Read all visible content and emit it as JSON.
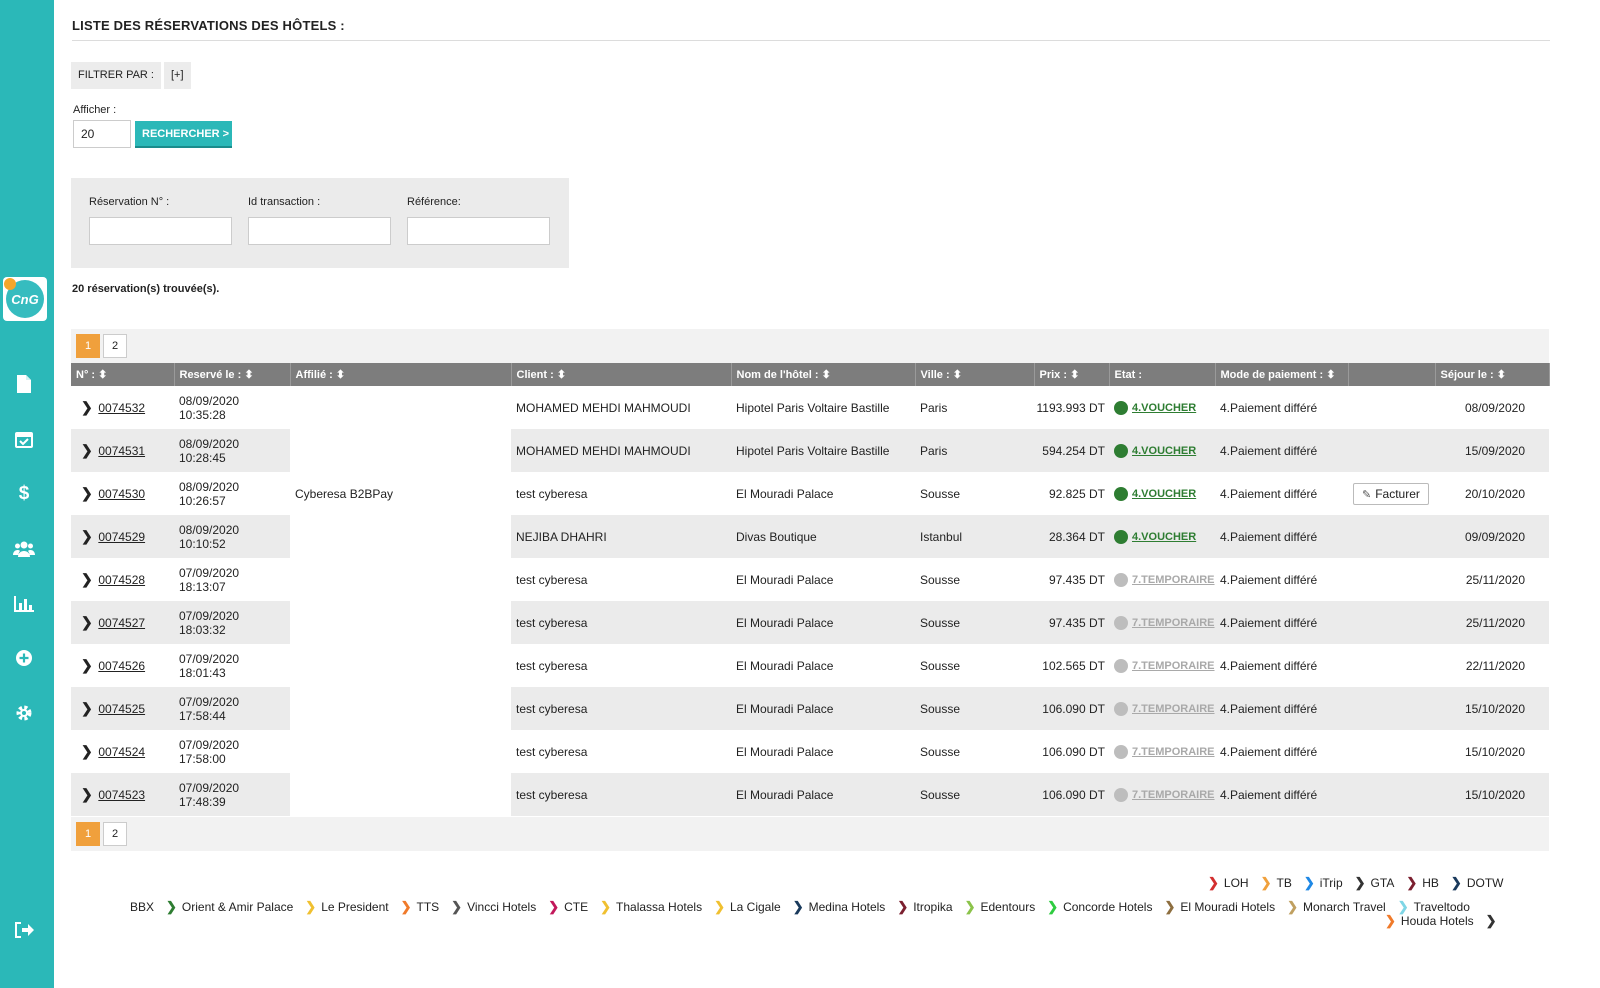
{
  "page": {
    "title": "LISTE DES RÉSERVATIONS DES HÔTELS :",
    "filter_label": "FILTRER PAR :",
    "filter_toggle": "[+]",
    "afficher_label": "Afficher :",
    "afficher_value": "20",
    "search_button": "RECHERCHER >",
    "found_text": "20 réservation(s) trouvée(s)."
  },
  "search": {
    "reservation_label": "Réservation N° :",
    "transaction_label": "Id transaction :",
    "reference_label": "Référence:"
  },
  "pagination": {
    "pages": [
      "1",
      "2"
    ],
    "current": "1"
  },
  "table": {
    "columns": [
      "N° : ⬍",
      "Reservé le : ⬍",
      "Affilié : ⬍",
      "Client : ⬍",
      "Nom de l'hôtel : ⬍",
      "Ville : ⬍",
      "Prix : ⬍",
      "Etat :",
      "Mode de paiement : ⬍",
      "",
      "Séjour le : ⬍"
    ],
    "facturer_label": "Facturer",
    "rows": [
      {
        "num": "0074532",
        "date": "08/09/2020",
        "time": "10:35:28",
        "affilie": "",
        "client": "MOHAMED MEHDI MAHMOUDI",
        "hotel": "Hipotel Paris Voltaire Bastille",
        "ville": "Paris",
        "prix": "1193.993 DT",
        "etat": "4.VOUCHER",
        "paiement": "4.Paiement différé",
        "sejour": "08/09/2020"
      },
      {
        "num": "0074531",
        "date": "08/09/2020",
        "time": "10:28:45",
        "affilie": "",
        "client": "MOHAMED MEHDI MAHMOUDI",
        "hotel": "Hipotel Paris Voltaire Bastille",
        "ville": "Paris",
        "prix": "594.254 DT",
        "etat": "4.VOUCHER",
        "paiement": "4.Paiement différé",
        "sejour": "15/09/2020"
      },
      {
        "num": "0074530",
        "date": "08/09/2020",
        "time": "10:26:57",
        "affilie": "Cyberesa B2BPay",
        "client": "test cyberesa",
        "hotel": "El Mouradi Palace",
        "ville": "Sousse",
        "prix": "92.825 DT",
        "etat": "4.VOUCHER",
        "paiement": "4.Paiement différé",
        "sejour": "20/10/2020"
      },
      {
        "num": "0074529",
        "date": "08/09/2020",
        "time": "10:10:52",
        "affilie": "",
        "client": "NEJIBA DHAHRI",
        "hotel": "Divas Boutique",
        "ville": "Istanbul",
        "prix": "28.364 DT",
        "etat": "4.VOUCHER",
        "paiement": "4.Paiement différé",
        "sejour": "09/09/2020"
      },
      {
        "num": "0074528",
        "date": "07/09/2020",
        "time": "18:13:07",
        "affilie": "",
        "client": "test cyberesa",
        "hotel": "El Mouradi Palace",
        "ville": "Sousse",
        "prix": "97.435 DT",
        "etat": "7.TEMPORAIRE",
        "paiement": "4.Paiement différé",
        "sejour": "25/11/2020"
      },
      {
        "num": "0074527",
        "date": "07/09/2020",
        "time": "18:03:32",
        "affilie": "",
        "client": "test cyberesa",
        "hotel": "El Mouradi Palace",
        "ville": "Sousse",
        "prix": "97.435 DT",
        "etat": "7.TEMPORAIRE",
        "paiement": "4.Paiement différé",
        "sejour": "25/11/2020"
      },
      {
        "num": "0074526",
        "date": "07/09/2020",
        "time": "18:01:43",
        "affilie": "",
        "client": "test cyberesa",
        "hotel": "El Mouradi Palace",
        "ville": "Sousse",
        "prix": "102.565 DT",
        "etat": "7.TEMPORAIRE",
        "paiement": "4.Paiement différé",
        "sejour": "22/11/2020"
      },
      {
        "num": "0074525",
        "date": "07/09/2020",
        "time": "17:58:44",
        "affilie": "",
        "client": "test cyberesa",
        "hotel": "El Mouradi Palace",
        "ville": "Sousse",
        "prix": "106.090 DT",
        "etat": "7.TEMPORAIRE",
        "paiement": "4.Paiement différé",
        "sejour": "15/10/2020"
      },
      {
        "num": "0074524",
        "date": "07/09/2020",
        "time": "17:58:00",
        "affilie": "",
        "client": "test cyberesa",
        "hotel": "El Mouradi Palace",
        "ville": "Sousse",
        "prix": "106.090 DT",
        "etat": "7.TEMPORAIRE",
        "paiement": "4.Paiement différé",
        "sejour": "15/10/2020"
      },
      {
        "num": "0074523",
        "date": "07/09/2020",
        "time": "17:48:39",
        "affilie": "",
        "client": "test cyberesa",
        "hotel": "El Mouradi Palace",
        "ville": "Sousse",
        "prix": "106.090 DT",
        "etat": "7.TEMPORAIRE",
        "paiement": "4.Paiement différé",
        "sejour": "15/10/2020"
      }
    ]
  },
  "status_colors": {
    "voucher": "#2e7d32",
    "temporaire": "#bdbdbd",
    "voucher_text": "#2e7d32",
    "temporaire_text": "#a9a9a9"
  },
  "colors": {
    "sidebar": "#2bb8b8",
    "accent_orange": "#f0a03c",
    "header_gray": "#7d7d7d"
  },
  "sidebar_icons": [
    "document-icon",
    "calendar-check-icon",
    "dollar-icon",
    "users-icon",
    "bar-chart-icon",
    "plus-circle-icon",
    "gear-icon",
    "logout-icon"
  ],
  "partners_row1": [
    {
      "name": "LOH",
      "color": "#d32f2f"
    },
    {
      "name": "TB",
      "color": "#f0a03c"
    },
    {
      "name": "iTrip",
      "color": "#1e88e5"
    },
    {
      "name": "GTA",
      "color": "#333333"
    },
    {
      "name": "HB",
      "color": "#7b1f2f"
    },
    {
      "name": "DOTW",
      "color": "#1a3a5c"
    }
  ],
  "partners_row2": [
    {
      "name": "BBX",
      "color": ""
    },
    {
      "name": "Orient & Amir Palace",
      "color": "#2e7d32"
    },
    {
      "name": "Le President",
      "color": "#f0c030"
    },
    {
      "name": "TTS",
      "color": "#f07a2a"
    },
    {
      "name": "Vincci Hotels",
      "color": "#555555"
    },
    {
      "name": "CTE",
      "color": "#c2185b"
    },
    {
      "name": "Thalassa Hotels",
      "color": "#f0c030"
    },
    {
      "name": "La Cigale",
      "color": "#f0c030"
    },
    {
      "name": "Medina Hotels",
      "color": "#1a3a5c"
    },
    {
      "name": "Itropika",
      "color": "#7b1f2f"
    },
    {
      "name": "Edentours",
      "color": "#8bc34a"
    },
    {
      "name": "Concorde Hotels",
      "color": "#2ecc40"
    },
    {
      "name": "El Mouradi Hotels",
      "color": "#8d6e3f"
    },
    {
      "name": "Monarch Travel",
      "color": "#c0a060"
    },
    {
      "name": "Traveltodo",
      "color": "#7fd6e6"
    }
  ],
  "partners_row3": [
    {
      "name": "Houda Hotels",
      "color": "#f07a2a"
    },
    {
      "name": "",
      "color": "#333333"
    }
  ]
}
